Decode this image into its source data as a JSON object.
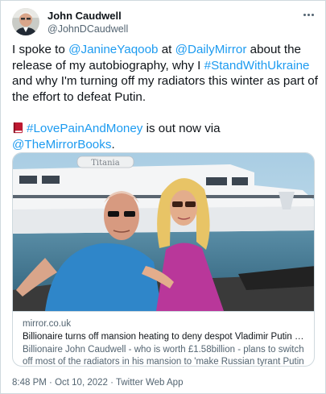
{
  "tweet": {
    "author": {
      "display_name": "John Caudwell",
      "handle": "@JohnDCaudwell",
      "avatar_icon": "profile-photo"
    },
    "more_icon": "more-options-icon",
    "text": {
      "line1_pre": "I spoke to ",
      "mention1": "@JanineYaqoob",
      "line1_mid": " at ",
      "mention2": "@DailyMirror",
      "line1_post": " about the release of my autobiography, why I ",
      "hashtag1": "#StandWithUkraine",
      "line1_end": " and why I'm turning off my radiators this winter as part of the effort to defeat Putin.",
      "emoji_icon": "red-book-icon",
      "hashtag2": "#LovePainAndMoney",
      "line2_mid": " is out now via ",
      "mention3": "@TheMirrorBooks",
      "line2_end": "."
    },
    "card": {
      "image_description_icon": "photo-man-and-woman-on-boat",
      "yacht_name": "Titania",
      "domain": "mirror.co.uk",
      "title": "Billionaire turns off mansion heating to deny despot Vladimir Putin fuel profits",
      "description": "Billionaire John Caudwell - who is worth £1.58billion - plans to switch off most of the radiators in his mansion to 'make Russian tyrant Putin a few dollars worse ..."
    },
    "meta": {
      "time": "8:48 PM",
      "separator1": " · ",
      "date": "Oct 10, 2022",
      "separator2": " · ",
      "source": "Twitter Web App"
    }
  },
  "colors": {
    "link": "#1d9bf0",
    "text": "#0f1419",
    "secondary": "#536471",
    "border": "#cfd9de"
  }
}
